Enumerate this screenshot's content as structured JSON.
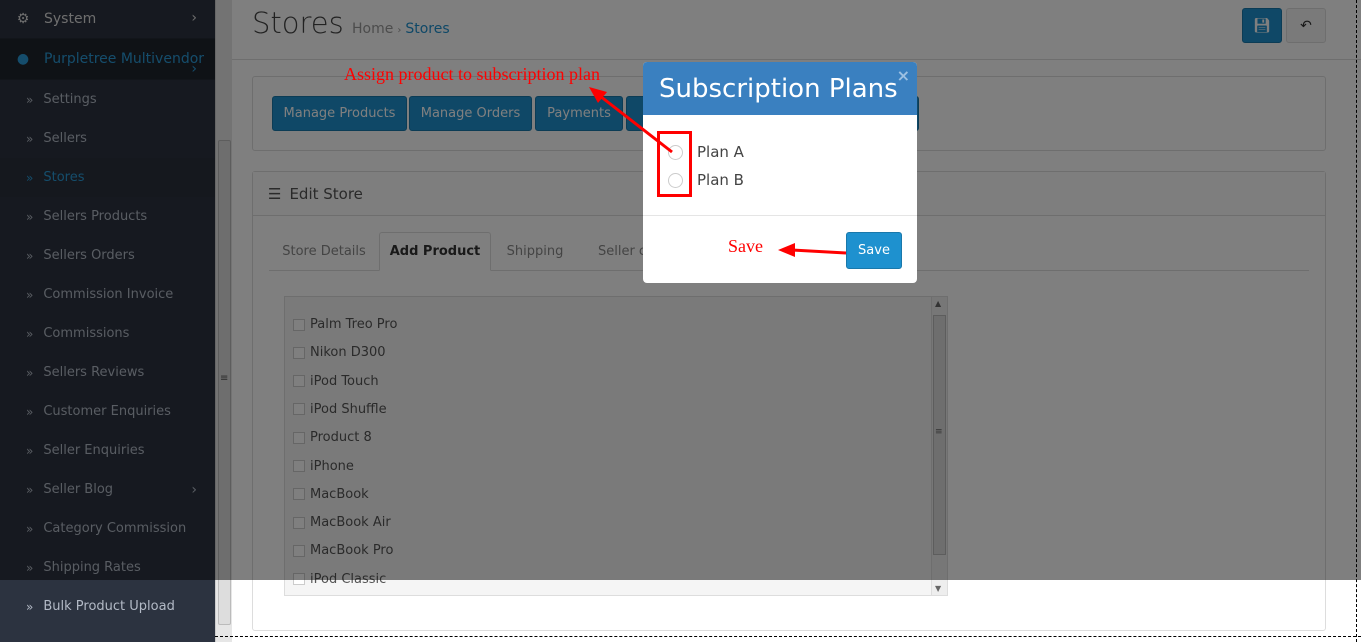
{
  "sidebar": {
    "system": "System",
    "plugin": "Purpletree Multivendor",
    "items": [
      {
        "label": "Settings"
      },
      {
        "label": "Sellers"
      },
      {
        "label": "Stores"
      },
      {
        "label": "Sellers Products"
      },
      {
        "label": "Sellers Orders"
      },
      {
        "label": "Commission Invoice"
      },
      {
        "label": "Commissions"
      },
      {
        "label": "Sellers Reviews"
      },
      {
        "label": "Customer Enquiries"
      },
      {
        "label": "Seller Enquiries"
      },
      {
        "label": "Seller Blog"
      },
      {
        "label": "Category Commission"
      },
      {
        "label": "Shipping Rates"
      },
      {
        "label": "Bulk Product Upload"
      }
    ]
  },
  "header": {
    "title": "Stores",
    "breadcrumb": [
      "Home",
      "Stores"
    ]
  },
  "toolbar": [
    "Manage Products",
    "Manage Orders",
    "Payments"
  ],
  "panel": {
    "title": "Edit Store",
    "tabs": [
      "Store Details",
      "Add Product",
      "Shipping",
      "Seller co"
    ]
  },
  "products": [
    "Palm Treo Pro",
    "Nikon D300",
    "iPod Touch",
    "iPod Shuffle",
    "Product 8",
    "iPhone",
    "MacBook",
    "MacBook Air",
    "MacBook Pro",
    "iPod Classic"
  ],
  "modal": {
    "title": "Subscription Plans",
    "close": "×",
    "plans": [
      "Plan A",
      "Plan B"
    ],
    "save": "Save"
  },
  "annotations": {
    "assign": "Assign product to subscription plan",
    "save": "Save"
  },
  "colors": {
    "primary": "#1e91cf",
    "modal_header": "#3a80c0",
    "annotation": "#ff0000"
  }
}
